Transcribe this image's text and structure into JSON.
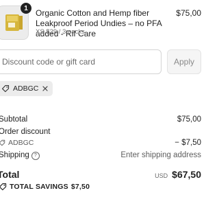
{
  "product": {
    "quantity": "1",
    "title": "Organic Cotton and Hemp fiber Leakproof Period Undies – no PFA added - Rif Care",
    "variant": "XS $29 / 3 packs",
    "price": "$75,00",
    "thumbnail_icon": "product-package-image"
  },
  "discount": {
    "placeholder": "Discount code or gift card",
    "apply_label": "Apply",
    "applied_code": "ADBGC"
  },
  "summary": {
    "subtotal_label": "Subtotal",
    "subtotal_value": "$75,00",
    "order_discount_label": "Order discount",
    "discount_code": "ADBGC",
    "discount_value": "− $7,50",
    "shipping_label": "Shipping",
    "shipping_value": "Enter shipping address",
    "total_label": "Total",
    "currency": "USD",
    "total_value": "$67,50",
    "savings_label": "TOTAL SAVINGS",
    "savings_value": "$7,50"
  },
  "colors": {
    "text": "#1f1f1f",
    "muted": "#6b6b6b",
    "chip_bg": "#ececec",
    "button_bg": "#f5f5f5"
  }
}
